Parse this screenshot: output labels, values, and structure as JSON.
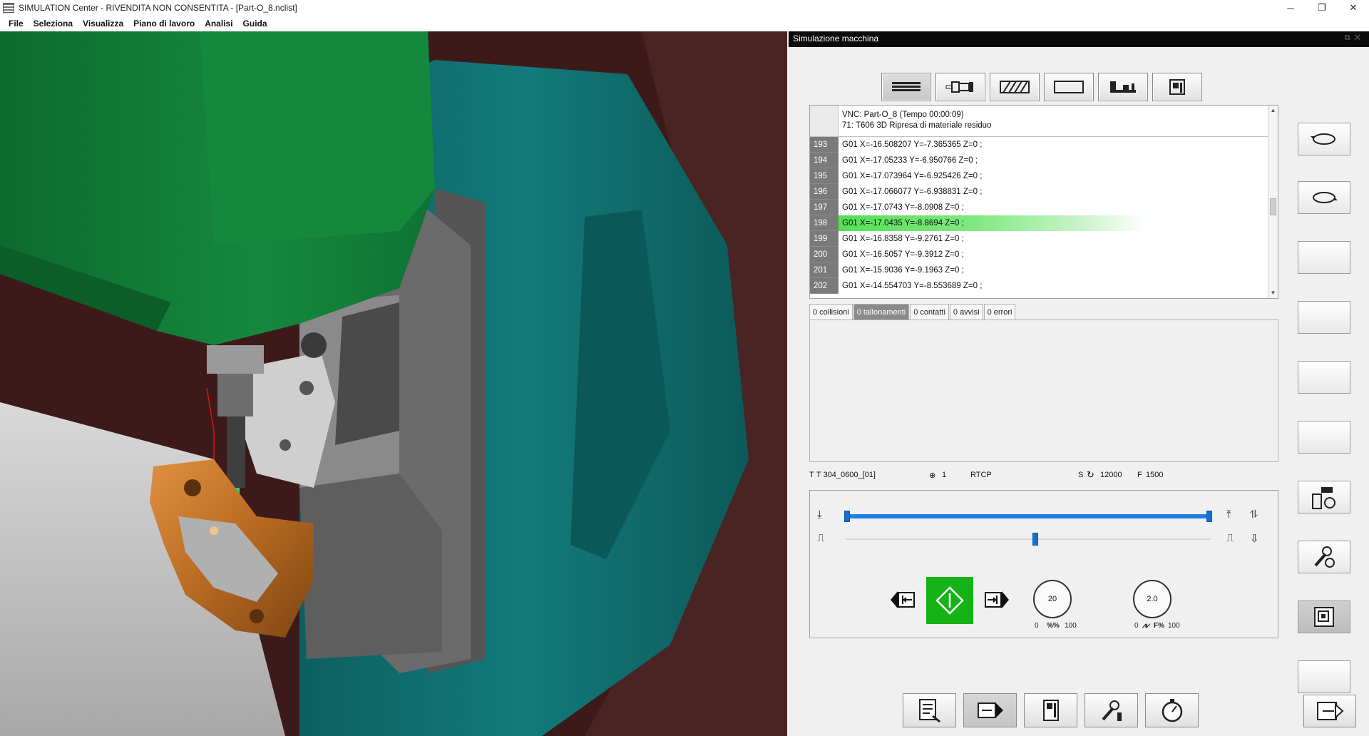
{
  "window": {
    "title": "SIMULATION Center - RIVENDITA NON CONSENTITA - [Part-O_8.nclist]",
    "controls": [
      "─",
      "❐",
      "✕"
    ]
  },
  "menu": [
    "File",
    "Seleziona",
    "Visualizza",
    "Piano di lavoro",
    "Analisi",
    "Guida"
  ],
  "colors": {
    "highlight": "#55e055",
    "slider": "#1e7fe0",
    "play": "#16b316",
    "spindle": "#1a8a3c",
    "fixture_teal": "#0e6f6f",
    "part_bronze": "#c9762a",
    "background_maroon": "#3d1a1a"
  },
  "panel": {
    "title": "Simulazione macchina",
    "toolbar_icons": [
      "nc-list-icon",
      "tool-icon",
      "stock-icon",
      "blank-view-icon",
      "machine-icon",
      "control-icon"
    ],
    "code_header": {
      "line1": "VNC: Part-O_8 (Tempo 00:00:09)",
      "line2": "71: T606 3D Ripresa di materiale residuo"
    },
    "code_lines": [
      {
        "num": "193",
        "code": "G01 X=-16.508207 Y=-7.365365 Z=0 ;"
      },
      {
        "num": "194",
        "code": "G01 X=-17.05233 Y=-6.950766 Z=0 ;"
      },
      {
        "num": "195",
        "code": "G01 X=-17.073964 Y=-6.925426 Z=0 ;"
      },
      {
        "num": "196",
        "code": "G01 X=-17.066077 Y=-6.938831 Z=0 ;"
      },
      {
        "num": "197",
        "code": "G01 X=-17.0743 Y=-8.0908 Z=0 ;"
      },
      {
        "num": "198",
        "code": "G01 X=-17.0435 Y=-8.8694 Z=0 ;"
      },
      {
        "num": "199",
        "code": "G01 X=-16.8358 Y=-9.2761 Z=0 ;"
      },
      {
        "num": "200",
        "code": "G01 X=-16.5057 Y=-9.3912 Z=0 ;"
      },
      {
        "num": "201",
        "code": "G01 X=-15.9036 Y=-9.1963 Z=0 ;"
      },
      {
        "num": "202",
        "code": "G01 X=-14.554703 Y=-8.553689 Z=0 ;"
      }
    ],
    "highlighted_line": "198",
    "tabs": [
      "0 collisioni",
      "0 tallonamenti",
      "0 contatti",
      "0 avvisi",
      "0 errori"
    ],
    "active_tab": "0 tallonamenti",
    "status": {
      "tool_label": "T",
      "tool": "T 304_0600_[01]",
      "origin": "1",
      "mode": "RTCP",
      "spindle_label": "S",
      "spindle_speed": "12000",
      "feed_label": "F",
      "feed": "1500"
    },
    "dials": {
      "speed": {
        "value": "20",
        "min": "0",
        "max": "100",
        "label": "%%"
      },
      "feed": {
        "value": "2.0",
        "min": "0",
        "max": "100",
        "label": "F%"
      }
    }
  }
}
